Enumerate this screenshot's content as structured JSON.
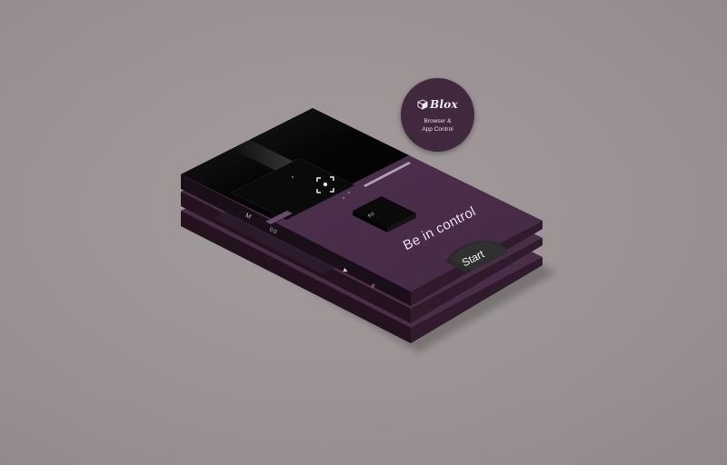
{
  "badge": {
    "brand": "Blox",
    "subtitle_line1": "Browser &",
    "subtitle_line2": "App Control",
    "logo_icon": "cube-icon"
  },
  "screen": {
    "headline": "Be in control",
    "start_label": "Start",
    "device_readout": "9:0",
    "scan_icon": "scan-frame-icon"
  },
  "back_layers": {
    "fragment_a": "M",
    "fragment_b": "0:0",
    "fragment_c": "II",
    "fragment_d": "▶"
  },
  "colors": {
    "background": "#9b9394",
    "purple": "#4a2d48",
    "purple_dark": "#2a1828",
    "black": "#050505"
  }
}
